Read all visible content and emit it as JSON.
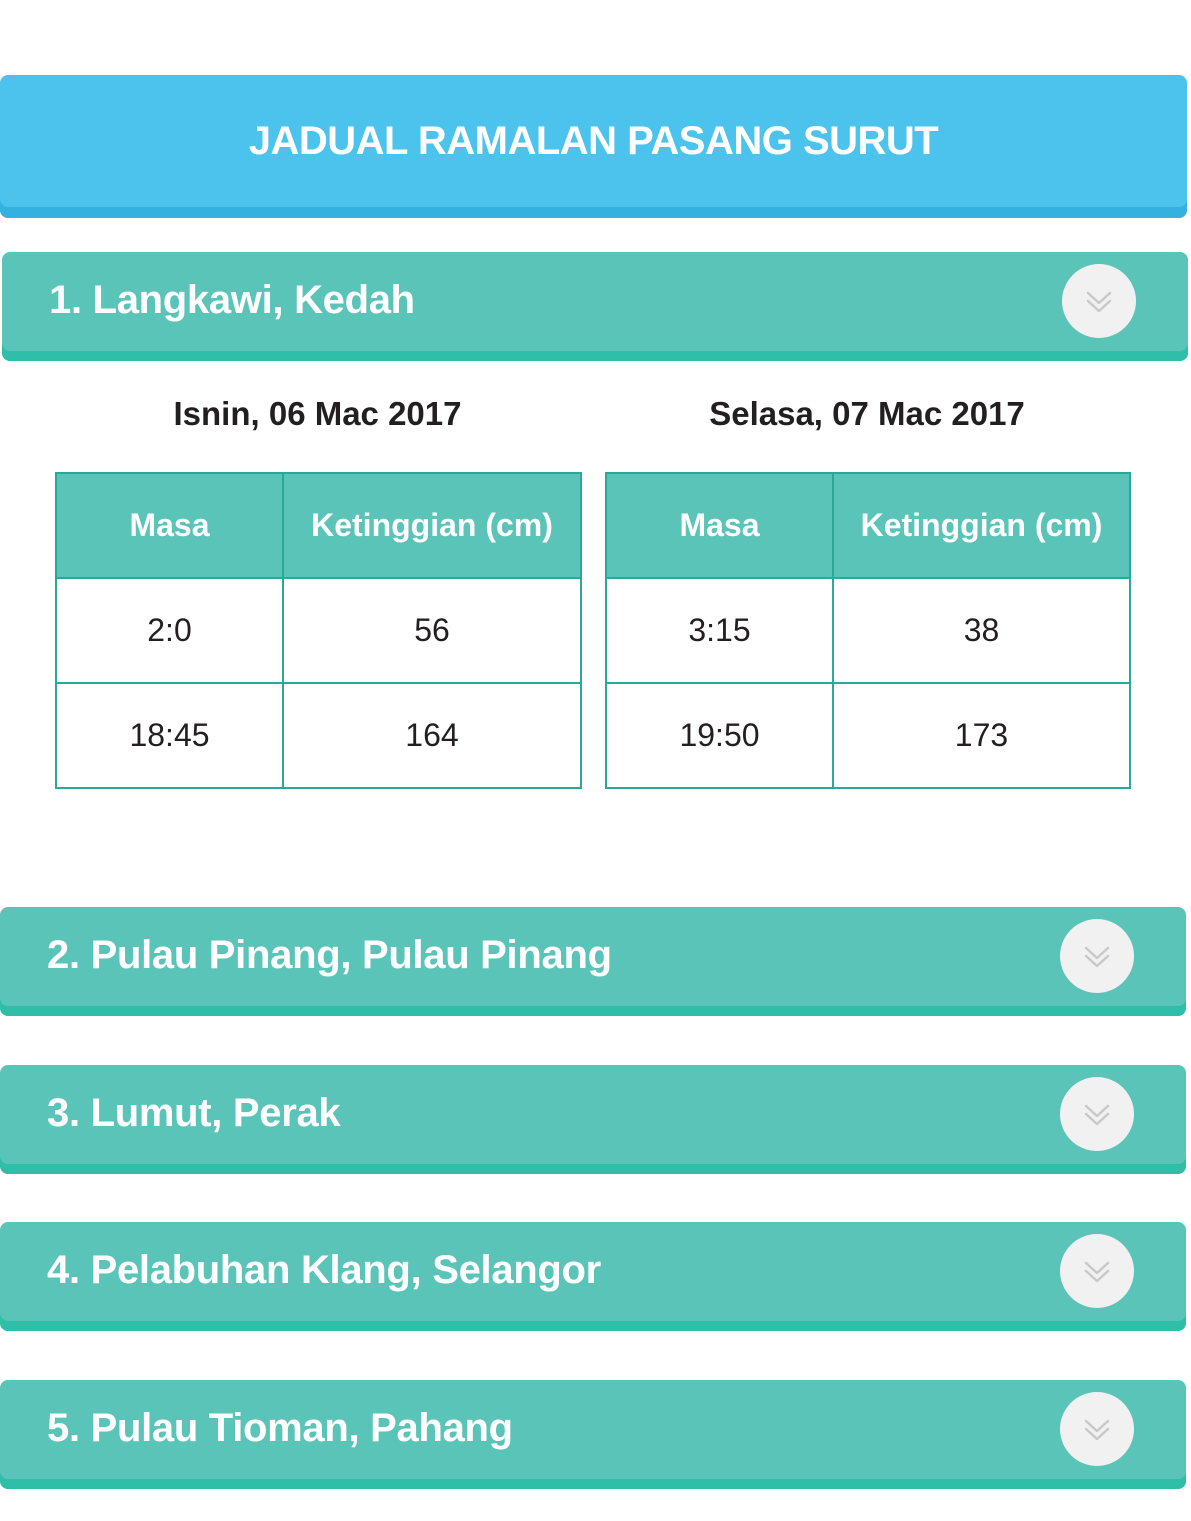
{
  "page_title": "JADUAL RAMALAN PASANG SURUT",
  "colors": {
    "title_bar": "#4bc3ec",
    "accordion": "#5bc4b8",
    "accordion_border": "#2fbfa9",
    "table_border": "#2aa898",
    "text_dark": "#231f20"
  },
  "locations": [
    {
      "label": "1. Langkawi, Kedah",
      "expanded": true,
      "icon": "double-chevron-down-icon"
    },
    {
      "label": "2. Pulau Pinang, Pulau Pinang",
      "expanded": false,
      "icon": "double-chevron-down-icon"
    },
    {
      "label": "3. Lumut, Perak",
      "expanded": false,
      "icon": "double-chevron-down-icon"
    },
    {
      "label": "4. Pelabuhan Klang, Selangor",
      "expanded": false,
      "icon": "double-chevron-down-icon"
    },
    {
      "label": "5. Pulau Tioman, Pahang",
      "expanded": false,
      "icon": "double-chevron-down-icon"
    }
  ],
  "langkawi": {
    "days": [
      {
        "date": "Isnin, 06 Mac 2017",
        "columns": [
          "Masa",
          "Ketinggian (cm)"
        ],
        "rows": [
          [
            "2:0",
            "56"
          ],
          [
            "18:45",
            "164"
          ]
        ]
      },
      {
        "date": "Selasa, 07 Mac 2017",
        "columns": [
          "Masa",
          "Ketinggian (cm)"
        ],
        "rows": [
          [
            "3:15",
            "38"
          ],
          [
            "19:50",
            "173"
          ]
        ]
      }
    ]
  }
}
